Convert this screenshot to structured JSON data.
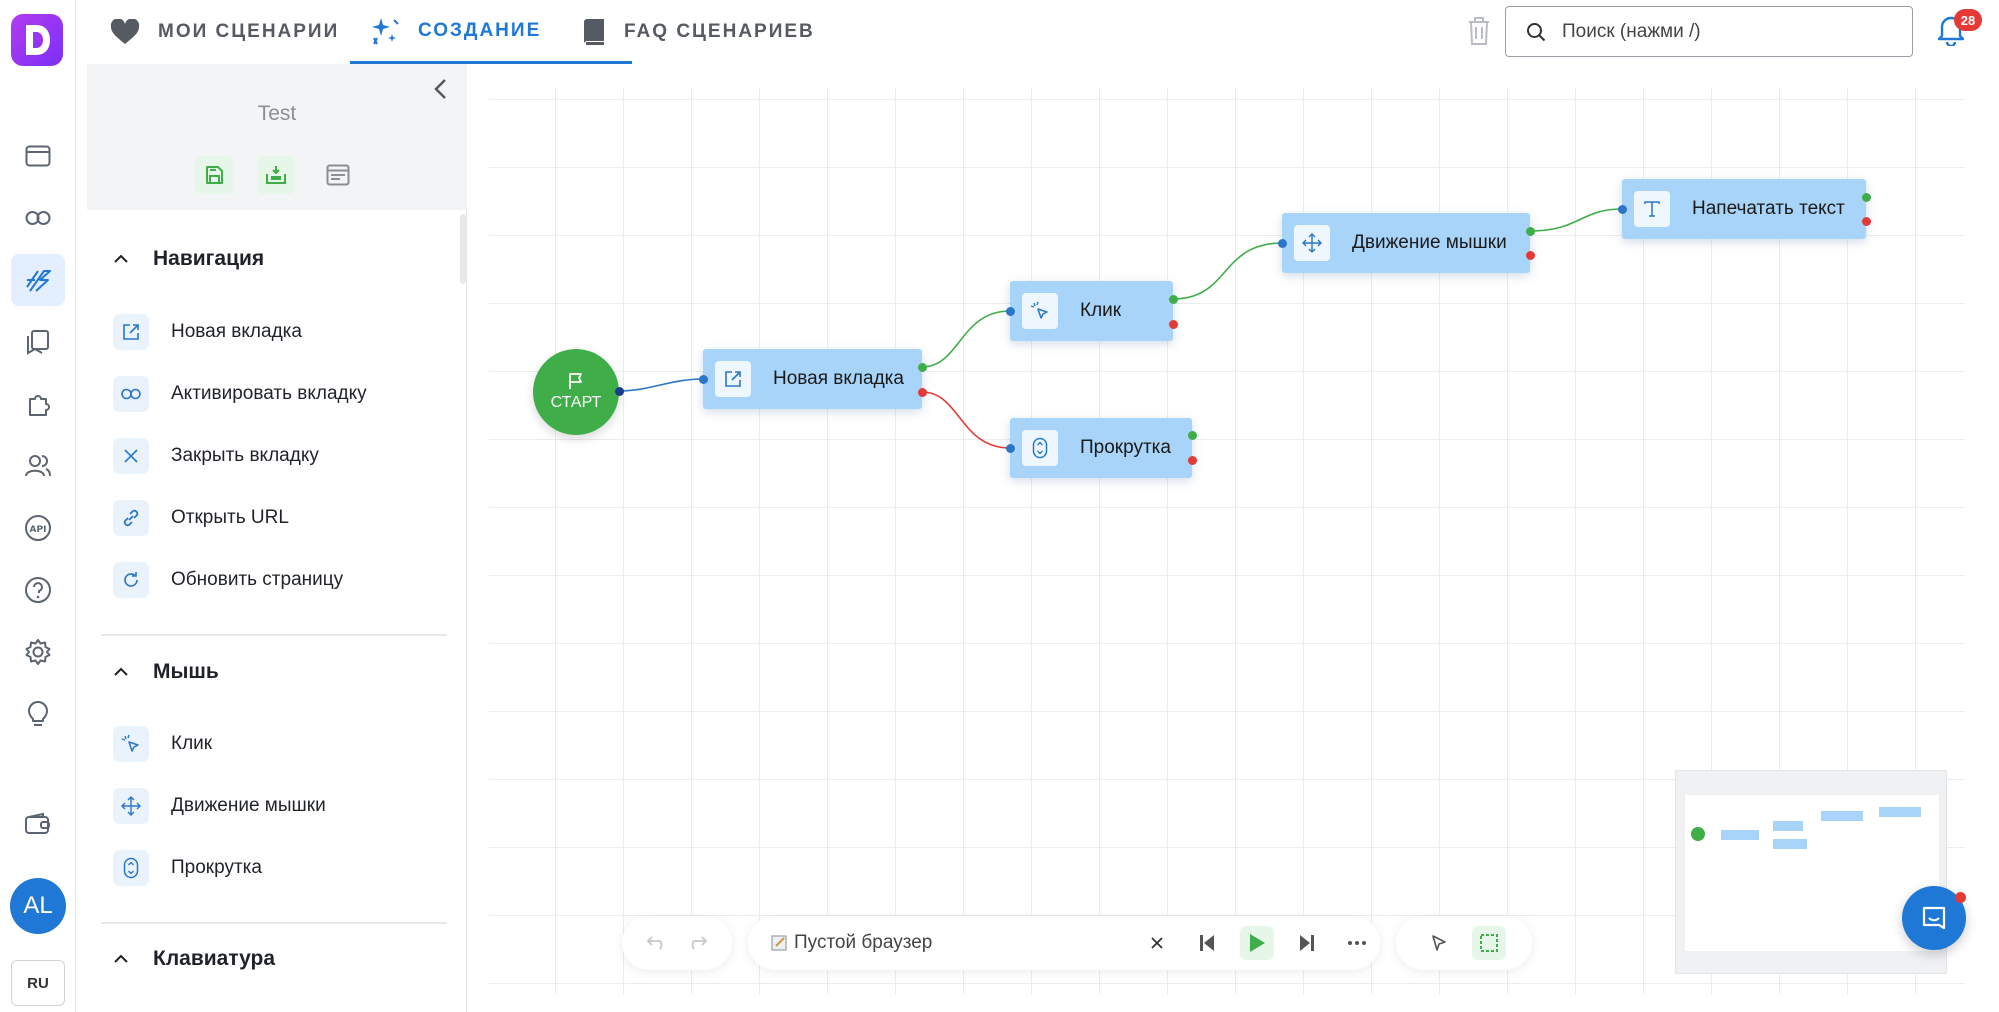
{
  "rail": {
    "avatar_initials": "AL",
    "lang": "RU"
  },
  "tabs": [
    {
      "label": "МОИ СЦЕНАРИИ",
      "icon": "heart-icon"
    },
    {
      "label": "СОЗДАНИЕ",
      "icon": "sparkle-icon",
      "active": true
    },
    {
      "label": "FAQ СЦЕНАРИЕВ",
      "icon": "book-icon"
    }
  ],
  "search": {
    "placeholder": "Поиск (нажми /)"
  },
  "notifications": {
    "count": "28"
  },
  "panel": {
    "title": "Test",
    "sections": [
      {
        "title": "Навигация",
        "items": [
          "Новая вкладка",
          "Активировать вкладку",
          "Закрыть вкладку",
          "Открыть URL",
          "Обновить страницу"
        ]
      },
      {
        "title": "Мышь",
        "items": [
          "Клик",
          "Движение мышки",
          "Прокрутка"
        ]
      },
      {
        "title": "Клавиатура",
        "items": []
      }
    ]
  },
  "canvas": {
    "start_label": "СТАРТ",
    "nodes": [
      "Новая вкладка",
      "Клик",
      "Прокрутка",
      "Движение мышки",
      "Напечатать текст"
    ]
  },
  "toolbar": {
    "browser_label": "Пустой браузер"
  },
  "colors": {
    "accent": "#1f78d6",
    "node": "#a8d4fa",
    "start": "#3fae49",
    "error": "#e53935"
  }
}
